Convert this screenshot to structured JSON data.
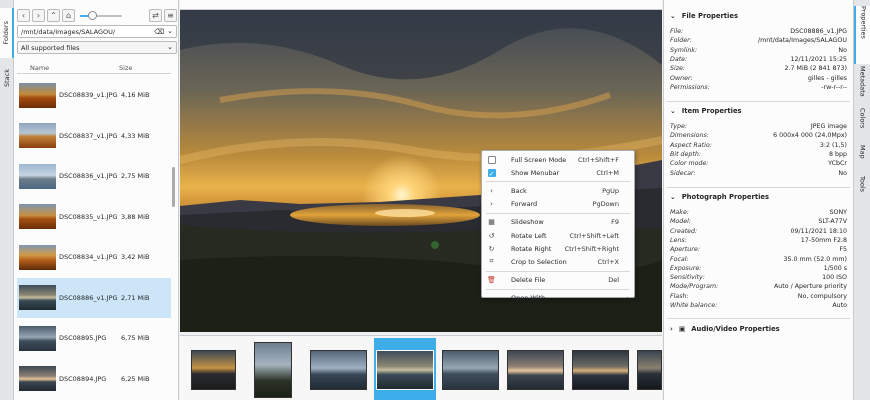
{
  "left_tabs": {
    "folders": "Folders",
    "stack": "Stack"
  },
  "toolbar": {
    "back_icon": "chevron-left-icon",
    "forward_icon": "chevron-right-icon",
    "up_icon": "arrow-up-icon",
    "home_icon": "home-icon",
    "zoom_level": 0.3,
    "sync_icon": "swap-icon",
    "menu_icon": "hamburger-icon"
  },
  "path": {
    "value": "/mnt/data/Images/SALAGOU/"
  },
  "filter": {
    "value": "All supported files"
  },
  "file_list": {
    "col_name": "Name",
    "col_size": "Size",
    "files": [
      {
        "name": "DSC08839_v1.JPG",
        "size": "4,16 MiB"
      },
      {
        "name": "DSC08837_v1.JPG",
        "size": "4,33 MiB"
      },
      {
        "name": "DSC08836_v1.JPG",
        "size": "2,75 MiB"
      },
      {
        "name": "DSC08835_v1.JPG",
        "size": "3,88 MiB"
      },
      {
        "name": "DSC08834_v1.JPG",
        "size": "3,42 MiB"
      },
      {
        "name": "DSC08886_v1.JPG",
        "size": "2,71 MiB"
      },
      {
        "name": "DSC08895.JPG",
        "size": "6,75 MiB"
      },
      {
        "name": "DSC08894.JPG",
        "size": "6,25 MiB"
      }
    ],
    "selected_index": 5
  },
  "context_menu": {
    "items": [
      {
        "icon": "checkbox-icon",
        "checked": false,
        "label": "Full Screen Mode",
        "shortcut": "Ctrl+Shift+F"
      },
      {
        "icon": "checkbox-icon",
        "checked": true,
        "label": "Show Menubar",
        "shortcut": "Ctrl+M"
      },
      {
        "icon": "chevron-left-icon",
        "label": "Back",
        "shortcut": "PgUp"
      },
      {
        "icon": "chevron-right-icon",
        "label": "Forward",
        "shortcut": "PgDown"
      },
      {
        "icon": "slideshow-icon",
        "label": "Slideshow",
        "shortcut": "F9"
      },
      {
        "icon": "rotate-left-icon",
        "label": "Rotate Left",
        "shortcut": "Ctrl+Shift+Left"
      },
      {
        "icon": "rotate-right-icon",
        "label": "Rotate Right",
        "shortcut": "Ctrl+Shift+Right"
      },
      {
        "icon": "crop-icon",
        "label": "Crop to Selection",
        "shortcut": "Ctrl+X"
      },
      {
        "icon": "trash-icon",
        "label": "Delete File",
        "shortcut": "Del"
      },
      {
        "icon": "",
        "label": "Open With",
        "shortcut": ""
      }
    ]
  },
  "file_properties": {
    "title": "File Properties",
    "rows": [
      {
        "k": "File:",
        "v": "DSC08886_v1.JPG"
      },
      {
        "k": "Folder:",
        "v": "/mnt/data/Images/SALAGOU"
      },
      {
        "k": "Symlink:",
        "v": "No"
      },
      {
        "k": "Date:",
        "v": "12/11/2021 15:25"
      },
      {
        "k": "Size:",
        "v": "2.7 MiB (2 841 873)"
      },
      {
        "k": "Owner:",
        "v": "gilles - gilles"
      },
      {
        "k": "Permissions:",
        "v": "-rw-r--r--"
      }
    ]
  },
  "item_properties": {
    "title": "Item Properties",
    "rows": [
      {
        "k": "Type:",
        "v": "JPEG image"
      },
      {
        "k": "Dimensions:",
        "v": "6 000x4 000 (24,0Mpx)"
      },
      {
        "k": "Aspect Ratio:",
        "v": "3:2 (1,5)"
      },
      {
        "k": "Bit depth:",
        "v": "8 bpp"
      },
      {
        "k": "Color mode:",
        "v": "YCbCr"
      },
      {
        "k": "Sidecar:",
        "v": "No"
      }
    ]
  },
  "photo_properties": {
    "title": "Photograph Properties",
    "rows": [
      {
        "k": "Make:",
        "v": "SONY"
      },
      {
        "k": "Model:",
        "v": "SLT-A77V"
      },
      {
        "k": "Created:",
        "v": "09/11/2021 18:10"
      },
      {
        "k": "Lens:",
        "v": "17-50mm F2.8"
      },
      {
        "k": "Aperture:",
        "v": "F5"
      },
      {
        "k": "Focal:",
        "v": "35.0 mm (52.0 mm)"
      },
      {
        "k": "Exposure:",
        "v": "1/500 s"
      },
      {
        "k": "Sensitivity:",
        "v": "100 ISO"
      },
      {
        "k": "Mode/Program:",
        "v": "Auto / Aperture priority"
      },
      {
        "k": "Flash:",
        "v": "No, compulsory"
      },
      {
        "k": "White balance:",
        "v": "Auto"
      }
    ]
  },
  "av_properties": {
    "title": "Audio/Video Properties"
  },
  "right_tabs": [
    "Properties",
    "Metadata",
    "Colors",
    "Map",
    "Tools"
  ],
  "colors": {
    "accent": "#3daee9",
    "selected_row": "#cde6f7"
  }
}
